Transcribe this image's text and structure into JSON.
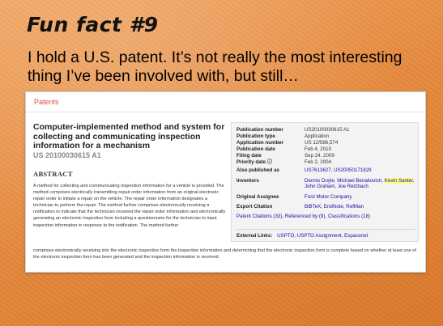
{
  "slide": {
    "title": "Fun fact #9",
    "body": "I hold a U.S. patent.  It’s not really the most interesting thing I’ve been involved with, but still…"
  },
  "patents_page": {
    "app_title": "Patents",
    "title": "Computer-implemented method and system for collecting and communicating inspection information for a mechanism",
    "number": "US 20100030615 A1",
    "abstract_heading": "ABSTRACT",
    "abstract_part1": "A method for collecting and communicating inspection information for a vehicle is provided. The method comprises electrically transmitting repair order information from an original electronic repair order to initiate a repair on the vehicle. The repair order information designates a technician to perform the repair. The method further comprises electronically receiving a notification to indicate that the technician received the repair order information and electronically generating an electronic inspection form including a questionnaire for the technician to input inspection information in response to the notification. The method further",
    "abstract_part2": "comprises electronically receiving into the electronic inspection form the inspection information and determining that the electronic inspection form is complete based on whether at least one of the electronic inspection form has been generated and the inspection information is received.",
    "metadata": {
      "publication_number": {
        "label": "Publication number",
        "value": "US20100030615 A1"
      },
      "publication_type": {
        "label": "Publication type",
        "value": "Application"
      },
      "application_number": {
        "label": "Application number",
        "value": "US 12/586,574"
      },
      "publication_date": {
        "label": "Publication date",
        "value": "Feb 4, 2010"
      },
      "filing_date": {
        "label": "Filing date",
        "value": "Sep 24, 2009"
      },
      "priority_date": {
        "label": "Priority date",
        "marker": "ⓘ",
        "value": "Feb 2, 2004"
      },
      "also_published_as": {
        "label": "Also published as",
        "links": [
          "US7613627",
          "US20050171829"
        ]
      },
      "inventors": {
        "label": "Inventors",
        "names": [
          "Dennis Doyle",
          "Michael Benakovich",
          "Kevin Santer",
          "John Graham",
          "Joe Retzbach"
        ]
      },
      "original_assignee": {
        "label": "Original Assignee",
        "value": "Ford Motor Company"
      },
      "export_citation": {
        "label": "Export Citation",
        "links": [
          "BiBTeX",
          "EndNote",
          "RefMan"
        ]
      },
      "citations": {
        "patent_citations": "Patent Citations (33)",
        "referenced_by": "Referenced by (9)",
        "classifications": "Classifications (18)"
      },
      "external_links": {
        "label": "External Links:",
        "links": [
          "USPTO",
          "USPTO Assignment",
          "Espacenet"
        ]
      }
    }
  }
}
